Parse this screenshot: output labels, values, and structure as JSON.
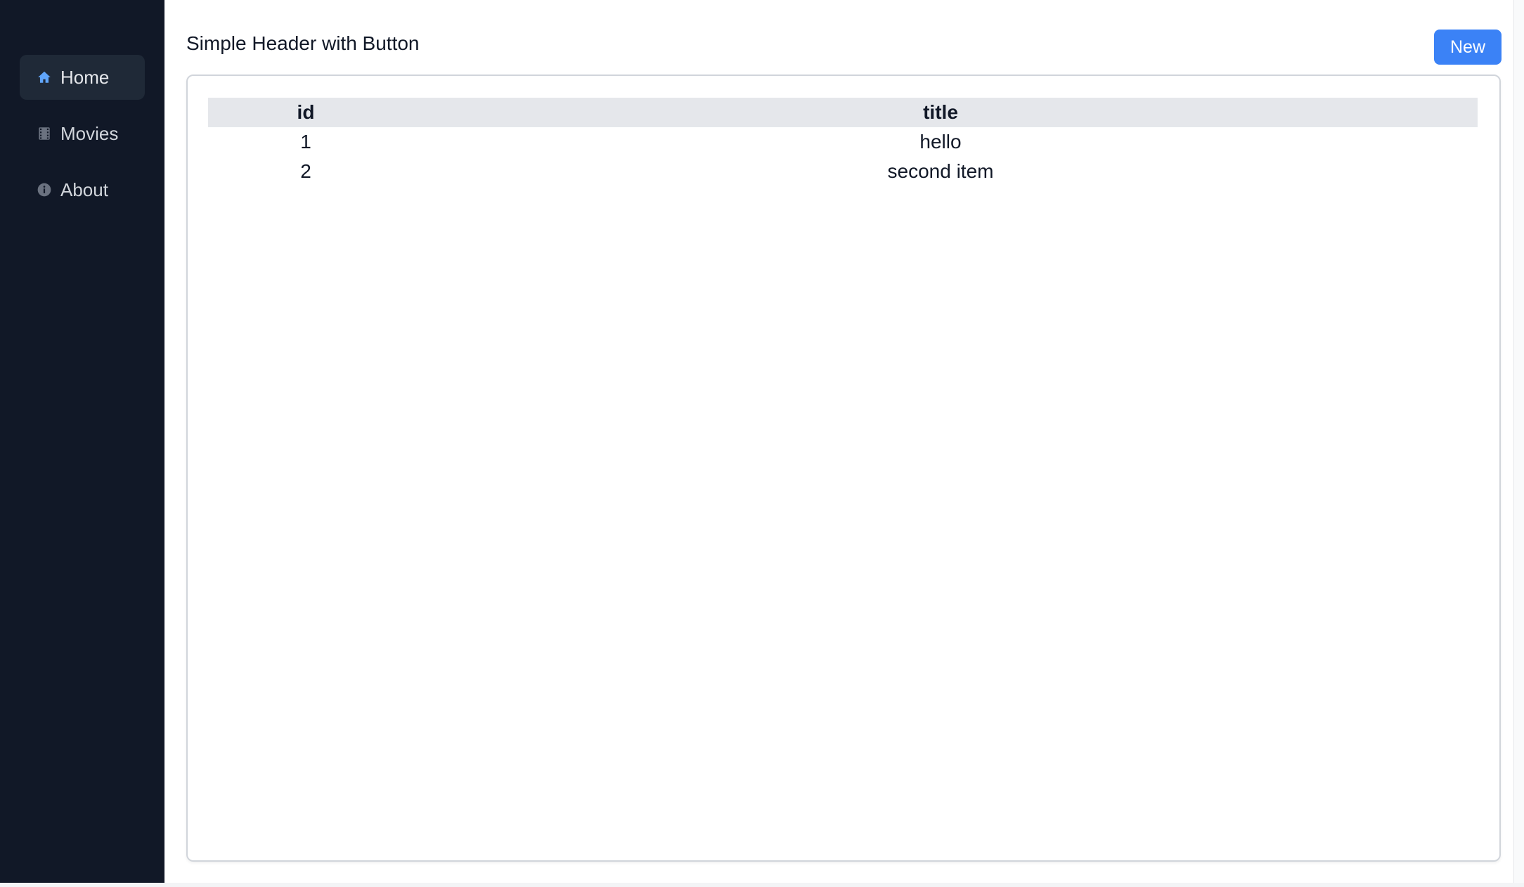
{
  "sidebar": {
    "items": [
      {
        "label": "Home",
        "icon": "home-icon",
        "active": true
      },
      {
        "label": "Movies",
        "icon": "film-icon",
        "active": false
      },
      {
        "label": "About",
        "icon": "info-icon",
        "active": false
      }
    ]
  },
  "header": {
    "title": "Simple Header with Button",
    "new_button_label": "New"
  },
  "table": {
    "columns": [
      "id",
      "title"
    ],
    "rows": [
      [
        "1",
        "hello"
      ],
      [
        "2",
        "second item"
      ]
    ]
  },
  "colors": {
    "sidebar_bg": "#111827",
    "active_item_bg": "#1f2937",
    "accent": "#3b82f6",
    "table_header_bg": "#e5e7eb"
  }
}
